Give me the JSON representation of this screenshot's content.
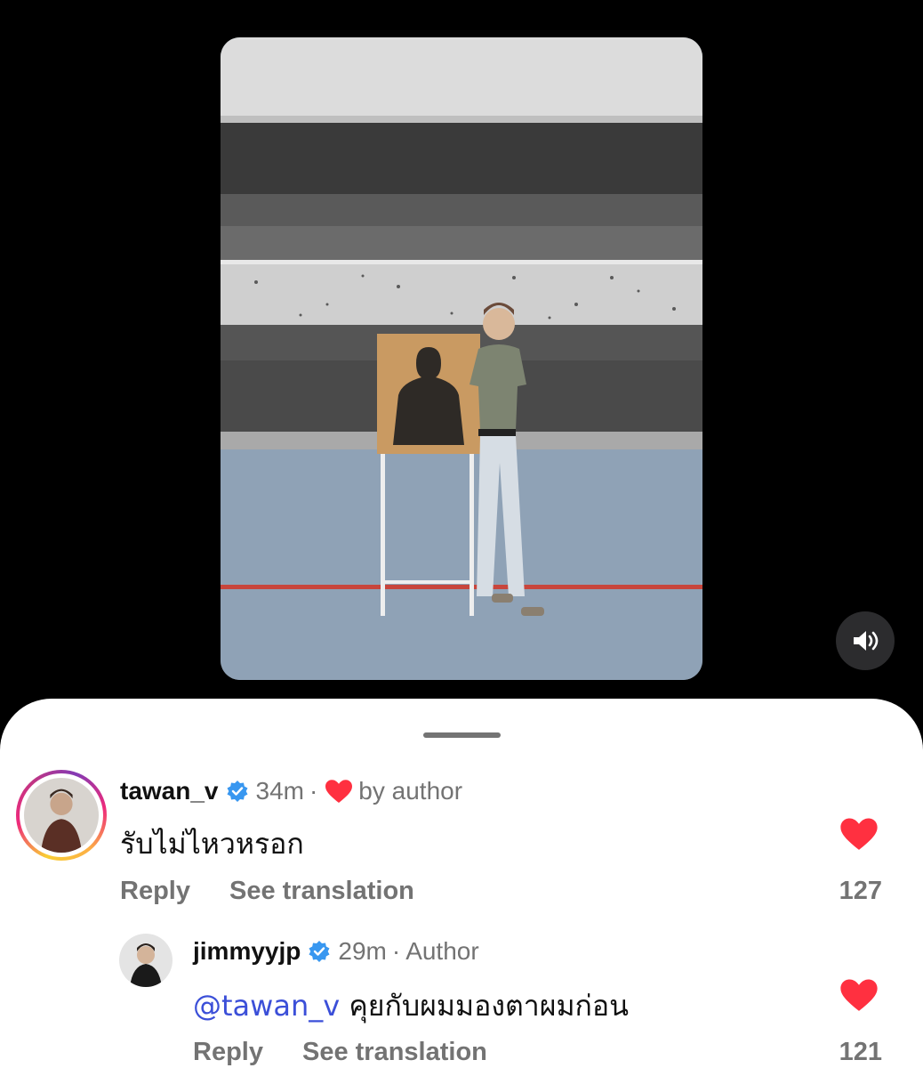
{
  "post": {
    "media_alt": "photo of a man standing next to a shooting target at an indoor range",
    "sound_icon": "speaker-volume-icon"
  },
  "comments": [
    {
      "username": "tawan_v",
      "verified": true,
      "time": "34m",
      "separator": "·",
      "badge_icon": "red-heart-icon",
      "badge_text": "by author",
      "text": "รับไม่ไหวหรอก",
      "reply_label": "Reply",
      "translate_label": "See translation",
      "like_count": "127",
      "liked": true
    },
    {
      "username": "jimmyyjp",
      "verified": true,
      "time": "29m",
      "separator": "·",
      "badge_text": "Author",
      "mention": "@tawan_v",
      "text": "คุยกับผมมองตาผมก่อน",
      "reply_label": "Reply",
      "translate_label": "See translation",
      "like_count": "121",
      "liked": true
    }
  ],
  "colors": {
    "like_red": "#ff3040",
    "verified_blue": "#3897f0",
    "mention_blue": "#3b4fd8",
    "muted_text": "#737373"
  }
}
